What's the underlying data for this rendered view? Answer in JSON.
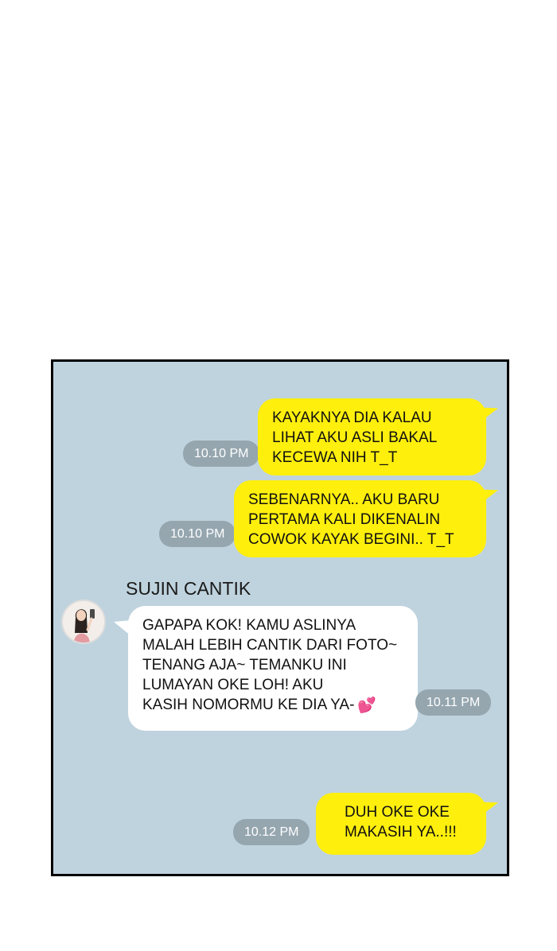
{
  "chat": {
    "messages": [
      {
        "direction": "outgoing",
        "time": "10.10 PM",
        "lines": [
          "KAYAKNYA DIA KALAU",
          "LIHAT AKU ASLI BAKAL",
          "KECEWA NIH T_T"
        ]
      },
      {
        "direction": "outgoing",
        "time": "10.10 PM",
        "lines": [
          "SEBENARNYA.. AKU BARU",
          "PERTAMA KALI DIKENALIN",
          "COWOK KAYAK BEGINI.. T_T"
        ]
      },
      {
        "direction": "incoming",
        "sender": "SUJIN CANTIK",
        "time": "10.11 PM",
        "lines": [
          "GAPAPA KOK! KAMU ASLINYA",
          "MALAH LEBIH CANTIK DARI FOTO~",
          "TENANG AJA~ TEMANKU INI",
          "LUMAYAN OKE LOH! AKU",
          "KASIH NOMORMU KE DIA YA-"
        ],
        "trailing_icon": "two-hearts-icon"
      },
      {
        "direction": "outgoing",
        "time": "10.12 PM",
        "lines": [
          "DUH OKE OKE",
          "MAKASIH  YA..!!!"
        ]
      }
    ]
  },
  "colors": {
    "chat_background": "#bfd3de",
    "outgoing_bubble": "#ffef0d",
    "incoming_bubble": "#ffffff",
    "timestamp_pill": "#95a6af"
  }
}
